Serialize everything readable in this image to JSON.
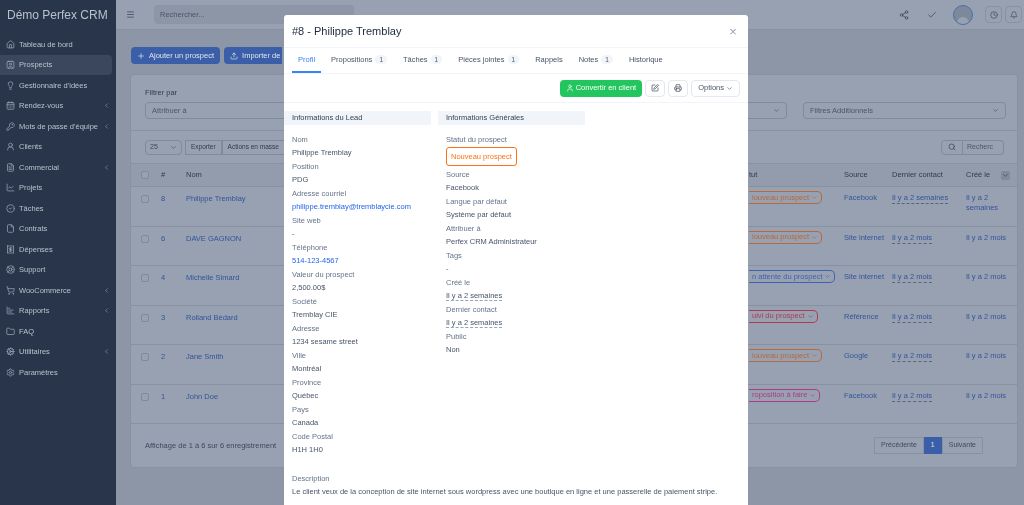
{
  "sidebar": {
    "brand": "Démo Perfex CRM",
    "items": [
      {
        "label": "Tableau de bord",
        "selected": false,
        "submenu": false
      },
      {
        "label": "Prospects",
        "selected": true,
        "submenu": false
      },
      {
        "label": "Gestionnaire d'idées",
        "selected": false,
        "submenu": false
      },
      {
        "label": "Rendez-vous",
        "selected": false,
        "submenu": true
      },
      {
        "label": "Mots de passe d'équipe",
        "selected": false,
        "submenu": true
      },
      {
        "label": "Clients",
        "selected": false,
        "submenu": false
      },
      {
        "label": "Commercial",
        "selected": false,
        "submenu": true
      },
      {
        "label": "Projets",
        "selected": false,
        "submenu": false
      },
      {
        "label": "Tâches",
        "selected": false,
        "submenu": false
      },
      {
        "label": "Contrats",
        "selected": false,
        "submenu": false
      },
      {
        "label": "Dépenses",
        "selected": false,
        "submenu": false
      },
      {
        "label": "Support",
        "selected": false,
        "submenu": false
      },
      {
        "label": "WooCommerce",
        "selected": false,
        "submenu": true
      },
      {
        "label": "Rapports",
        "selected": false,
        "submenu": true
      },
      {
        "label": "FAQ",
        "selected": false,
        "submenu": false
      },
      {
        "label": "Utilitaires",
        "selected": false,
        "submenu": true
      },
      {
        "label": "Paramètres",
        "selected": false,
        "submenu": false
      }
    ]
  },
  "header": {
    "search_placeholder": "Rechercher..."
  },
  "actions": [
    "Ajouter un prospect",
    "Importer de"
  ],
  "filters": {
    "label": "Filtrer par",
    "assign_placeholder": "Attribuer à",
    "extra_placeholder": "Filtres Additionnels"
  },
  "toolbar": {
    "page_size": "25",
    "buttons": [
      "Exporter",
      "Actions en masse"
    ],
    "search_placeholder": "Recherc"
  },
  "table": {
    "columns": [
      "#",
      "Nom",
      "tut",
      "Source",
      "Dernier contact",
      "Créé le"
    ],
    "select_all_checked": false,
    "rows": [
      {
        "checked": false,
        "id": "8",
        "name": "Philippe Tremblay",
        "status": "louveau prospect",
        "color": "#b8683a",
        "source": "Facebook",
        "last_contact": "Il y a 2 semaines",
        "created": "Il y a 2 semaines"
      },
      {
        "checked": false,
        "id": "6",
        "name": "DAVE GAGNON",
        "status": "louveau prospect",
        "color": "#b8683a",
        "source": "Site internet",
        "last_contact": "Il y a 2 mois",
        "created": "Il y a 2 mois"
      },
      {
        "checked": false,
        "id": "4",
        "name": "Michelle Simard",
        "status": "n attente du prospect",
        "color": "#3f63b0",
        "source": "Site internet",
        "last_contact": "Il y a 2 mois",
        "created": "Il y a 2 mois"
      },
      {
        "checked": false,
        "id": "3",
        "name": "Rolland Bédard",
        "status": "uivi du prospect",
        "color": "#b03a4e",
        "source": "Référence",
        "last_contact": "Il y a 2 mois",
        "created": "Il y a 2 mois"
      },
      {
        "checked": false,
        "id": "2",
        "name": "Jane Smith",
        "status": "louveau prospect",
        "color": "#b8683a",
        "source": "Google",
        "last_contact": "Il y a 2 mois",
        "created": "Il y a 2 mois"
      },
      {
        "checked": false,
        "id": "1",
        "name": "John Doe",
        "status": "roposition à faire",
        "color": "#b03a86",
        "source": "Facebook",
        "last_contact": "Il y a 2 mois",
        "created": "Il y a 2 mois"
      }
    ],
    "footer": "Affichage de 1 à 6 sur 6 enregistrement",
    "pagination": [
      {
        "label": "Précédente",
        "selected": false
      },
      {
        "label": "1",
        "selected": true
      },
      {
        "label": "Suivante",
        "selected": false
      }
    ]
  },
  "modal": {
    "title": "#8 - Philippe Tremblay",
    "close": "×",
    "tabs": [
      {
        "label": "Profil",
        "selected": true
      },
      {
        "label": "Propositions",
        "count": "1",
        "selected": false
      },
      {
        "label": "Tâches",
        "count": "1",
        "selected": false
      },
      {
        "label": "Pièces jointes",
        "count": "1",
        "selected": false
      },
      {
        "label": "Rappels",
        "selected": false
      },
      {
        "label": "Notes",
        "count": "1",
        "selected": false
      },
      {
        "label": "Historique",
        "selected": false
      }
    ],
    "convert_button": "Convertir en client",
    "options_button": "Options",
    "sections": [
      {
        "title": "Informations du Lead",
        "fields": [
          {
            "label": "Nom",
            "value": "Philippe Tremblay",
            "kind": "text"
          },
          {
            "label": "Position",
            "value": "PDG",
            "kind": "text"
          },
          {
            "label": "Adresse courriel",
            "value": "philippe.tremblay@tremblaycie.com",
            "kind": "link"
          },
          {
            "label": "Site web",
            "value": "-",
            "kind": "text"
          },
          {
            "label": "Téléphone",
            "value": "514-123-4567",
            "kind": "link"
          },
          {
            "label": "Valeur du prospect",
            "value": "2,500.00$",
            "kind": "text"
          },
          {
            "label": "Société",
            "value": "Tremblay CIE",
            "kind": "text"
          },
          {
            "label": "Adresse",
            "value": "1234 sesame street",
            "kind": "text"
          },
          {
            "label": "Ville",
            "value": "Montréal",
            "kind": "text"
          },
          {
            "label": "Province",
            "value": "Québec",
            "kind": "text"
          },
          {
            "label": "Pays",
            "value": "Canada",
            "kind": "text"
          },
          {
            "label": "Code Postal",
            "value": "H1H 1H0",
            "kind": "text"
          }
        ]
      },
      {
        "title": "Informations Générales",
        "fields": [
          {
            "label": "Statut du prospect",
            "value": "Nouveau prospect",
            "kind": "badge",
            "color": "#f97316"
          },
          {
            "label": "Source",
            "value": "Facebook",
            "kind": "text"
          },
          {
            "label": "Langue par défaut",
            "value": "Système par défaut",
            "kind": "text"
          },
          {
            "label": "Attribuer à",
            "value": "Perfex CRM Administrateur",
            "kind": "text"
          },
          {
            "label": "Tags",
            "value": "-",
            "kind": "text"
          },
          {
            "label": "Créé le",
            "value": "Il y a 2 semaines",
            "kind": "date"
          },
          {
            "label": "Dernier contact",
            "value": "Il y a 2 semaines",
            "kind": "date"
          },
          {
            "label": "Public",
            "value": "Non",
            "kind": "text"
          }
        ]
      }
    ],
    "description": {
      "label": "Description",
      "value": "Le client veux de la conception de site internet sous wordpress avec une boutique en ligne et une passerelle de paiement stripe."
    }
  }
}
